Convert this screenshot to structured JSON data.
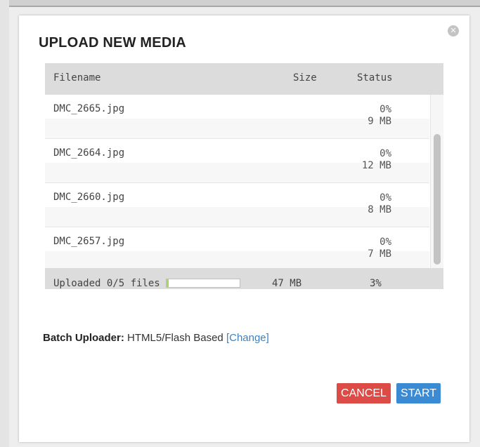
{
  "dialog": {
    "title": "UPLOAD NEW MEDIA",
    "close_glyph": "✕",
    "close_icon": "close-circle-icon"
  },
  "table": {
    "headers": {
      "filename": "Filename",
      "size": "Size",
      "status": "Status"
    },
    "rows": [
      {
        "filename": "DMC_2665.jpg",
        "percent": "0%",
        "size": "9 MB"
      },
      {
        "filename": "DMC_2664.jpg",
        "percent": "0%",
        "size": "12 MB"
      },
      {
        "filename": "DMC_2660.jpg",
        "percent": "0%",
        "size": "8 MB"
      },
      {
        "filename": "DMC_2657.jpg",
        "percent": "0%",
        "size": "7 MB"
      }
    ],
    "footer": {
      "label": "Uploaded 0/5 files",
      "total_size": "47 MB",
      "total_percent": "3%",
      "progress_fraction": 0.03
    }
  },
  "batch": {
    "label": "Batch Uploader:",
    "value": "HTML5/Flash Based",
    "change_link": "[Change]"
  },
  "buttons": {
    "cancel": "CANCEL",
    "start": "START"
  },
  "colors": {
    "cancel": "#dc4b46",
    "start": "#3a8bd4",
    "link": "#3b82c4",
    "progress_fill": "#a6d95a",
    "header_bg": "#dcdcdc"
  }
}
